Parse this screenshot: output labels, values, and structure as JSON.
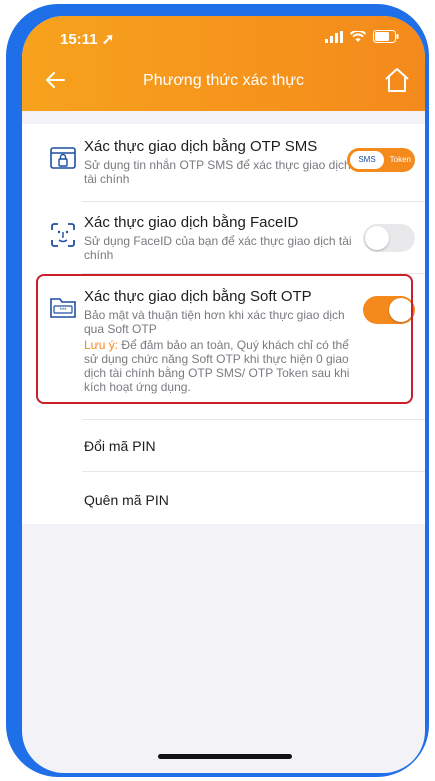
{
  "status": {
    "time": "15:11"
  },
  "nav": {
    "title": "Phương thức xác thực"
  },
  "options": [
    {
      "title": "Xác thực giao dịch bằng OTP SMS",
      "desc": "Sử dụng tin nhắn OTP SMS để xác thực giao dịch tài chính",
      "control": {
        "type": "segmented",
        "selected": "SMS",
        "other": "Token"
      }
    },
    {
      "title": "Xác thực giao dịch bằng FaceID",
      "desc": "Sử dụng FaceID của bạn để xác thực giao dịch tài chính",
      "control": {
        "type": "toggle",
        "on": false
      }
    },
    {
      "title": "Xác thực giao dịch bằng Soft OTP",
      "desc": "Bảo mật và thuận tiện hơn khi xác thực giao dịch qua Soft OTP",
      "control": {
        "type": "toggle",
        "on": true
      },
      "note_label": "Lưu ý:",
      "note_text": " Để đảm bảo an toàn, Quý khách chỉ có thể sử dụng chức năng Soft OTP khi thực hiện 0 giao dịch tài chính bằng OTP SMS/ OTP Token sau khi kích hoạt ứng dụng."
    }
  ],
  "pin": {
    "change": "Đổi mã PIN",
    "forgot": "Quên mã PIN"
  },
  "colors": {
    "accent": "#f48a1c",
    "highlight": "#c9202c",
    "frame": "#1f6fe8"
  }
}
